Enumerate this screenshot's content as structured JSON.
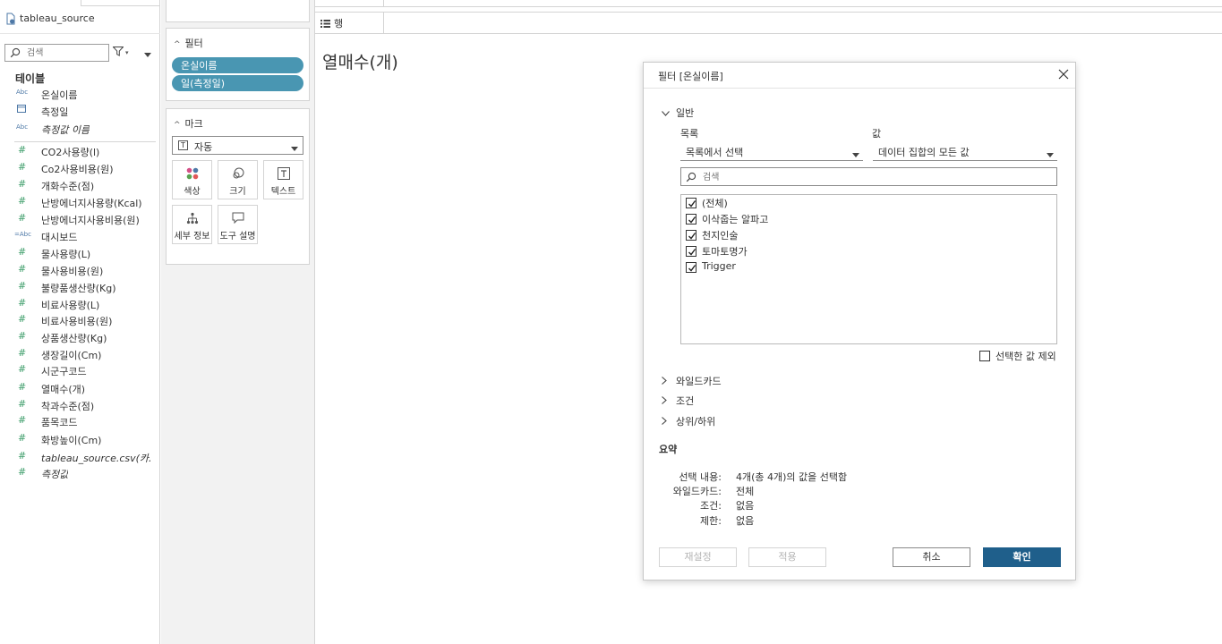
{
  "colors": {
    "pill": "#4996b2",
    "primary_button": "#1f5f8b",
    "measure_icon": "#3f9e6b",
    "dimension_icon": "#4e79a7"
  },
  "data_pane": {
    "datasource_name": "tableau_source",
    "search": {
      "placeholder": "검색"
    },
    "tables_title": "테이블",
    "fields": [
      {
        "name": "온실이름",
        "icon": "Abc",
        "type": "string"
      },
      {
        "name": "측정일",
        "icon": "calendar-icon",
        "type": "date"
      },
      {
        "name": "측정값 이름",
        "icon": "Abc",
        "type": "string",
        "italic": true
      },
      {
        "name": "CO2사용량(l)",
        "icon": "#",
        "type": "measure"
      },
      {
        "name": "Co2사용비용(원)",
        "icon": "#",
        "type": "measure"
      },
      {
        "name": "개화수준(점)",
        "icon": "#",
        "type": "measure"
      },
      {
        "name": "난방에너지사용량(Kcal)",
        "icon": "#",
        "type": "measure"
      },
      {
        "name": "난방에너지사용비용(원)",
        "icon": "#",
        "type": "measure"
      },
      {
        "name": "대시보드",
        "icon": "=Abc",
        "type": "calc-string"
      },
      {
        "name": "물사용량(L)",
        "icon": "#",
        "type": "measure"
      },
      {
        "name": "물사용비용(원)",
        "icon": "#",
        "type": "measure"
      },
      {
        "name": "불량품생산량(Kg)",
        "icon": "#",
        "type": "measure"
      },
      {
        "name": "비료사용량(L)",
        "icon": "#",
        "type": "measure"
      },
      {
        "name": "비료사용비용(원)",
        "icon": "#",
        "type": "measure"
      },
      {
        "name": "상품생산량(Kg)",
        "icon": "#",
        "type": "measure"
      },
      {
        "name": "생장길이(Cm)",
        "icon": "#",
        "type": "measure"
      },
      {
        "name": "시군구코드",
        "icon": "#",
        "type": "measure"
      },
      {
        "name": "열매수(개)",
        "icon": "#",
        "type": "measure"
      },
      {
        "name": "착과수준(점)",
        "icon": "#",
        "type": "measure"
      },
      {
        "name": "품목코드",
        "icon": "#",
        "type": "measure"
      },
      {
        "name": "화방높이(Cm)",
        "icon": "#",
        "type": "measure"
      },
      {
        "name": "tableau_source.csv(카...",
        "icon": "#",
        "type": "measure",
        "italic": true
      },
      {
        "name": "측정값",
        "icon": "#",
        "type": "measure",
        "italic": true
      }
    ]
  },
  "shelves": {
    "filters_title": "필터",
    "filter_pills": [
      "온실이름",
      "일(측정일)"
    ],
    "marks_title": "마크",
    "mark_type": "자동",
    "mark_buttons": [
      {
        "label": "색상",
        "icon": "color-icon"
      },
      {
        "label": "크기",
        "icon": "size-icon"
      },
      {
        "label": "텍스트",
        "icon": "text-icon"
      },
      {
        "label": "세부 정보",
        "icon": "detail-icon"
      },
      {
        "label": "도구 설명",
        "icon": "tooltip-icon"
      }
    ]
  },
  "workspace": {
    "rows_label": "행",
    "sheet_title": "열매수(개)"
  },
  "dialog": {
    "title": "필터 [온실이름]",
    "general_label": "일반",
    "list_label": "목록",
    "value_label": "값",
    "list_select": "목록에서 선택",
    "value_select": "데이터 집합의 모든 값",
    "search_placeholder": "검색",
    "items": [
      {
        "label": "(전체)",
        "checked": true
      },
      {
        "label": "이삭줍는 알파고",
        "checked": true
      },
      {
        "label": "천지인술",
        "checked": true
      },
      {
        "label": "토마토명가",
        "checked": true
      },
      {
        "label": "Trigger",
        "checked": true
      }
    ],
    "exclude_label": "선택한 값 제외",
    "exclude_checked": false,
    "sections": [
      "와일드카드",
      "조건",
      "상위/하위"
    ],
    "summary_title": "요약",
    "summary": [
      {
        "key": "선택 내용:",
        "value": "4개(총 4개)의 값을 선택함"
      },
      {
        "key": "와일드카드:",
        "value": "전체"
      },
      {
        "key": "조건:",
        "value": "없음"
      },
      {
        "key": "제한:",
        "value": "없음"
      }
    ],
    "buttons": {
      "reset": "재설정",
      "apply": "적용",
      "cancel": "취소",
      "ok": "확인"
    }
  }
}
